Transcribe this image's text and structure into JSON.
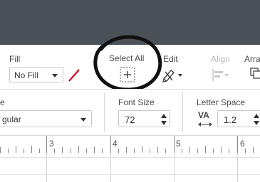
{
  "toolbar": {
    "fill_label": "Fill",
    "fill_value": "No Fill",
    "select_all_label": "Select All",
    "edit_label": "Edit",
    "align_label": "Align",
    "arrange_label": "Arra"
  },
  "text_toolbar": {
    "font_style_label": "e",
    "font_style_value": "gular",
    "font_size_label": "Font Size",
    "font_size_value": "72",
    "letter_space_label": "Letter Space",
    "letter_space_icon_text": "VA",
    "letter_space_value": "1.2"
  },
  "ruler": {
    "numbers": [
      "3",
      "4",
      "5",
      "6"
    ]
  },
  "colors": {
    "top_bar": "#4a5258",
    "highlight_circle": "#111111",
    "no_fill_slash": "#d0021b"
  }
}
